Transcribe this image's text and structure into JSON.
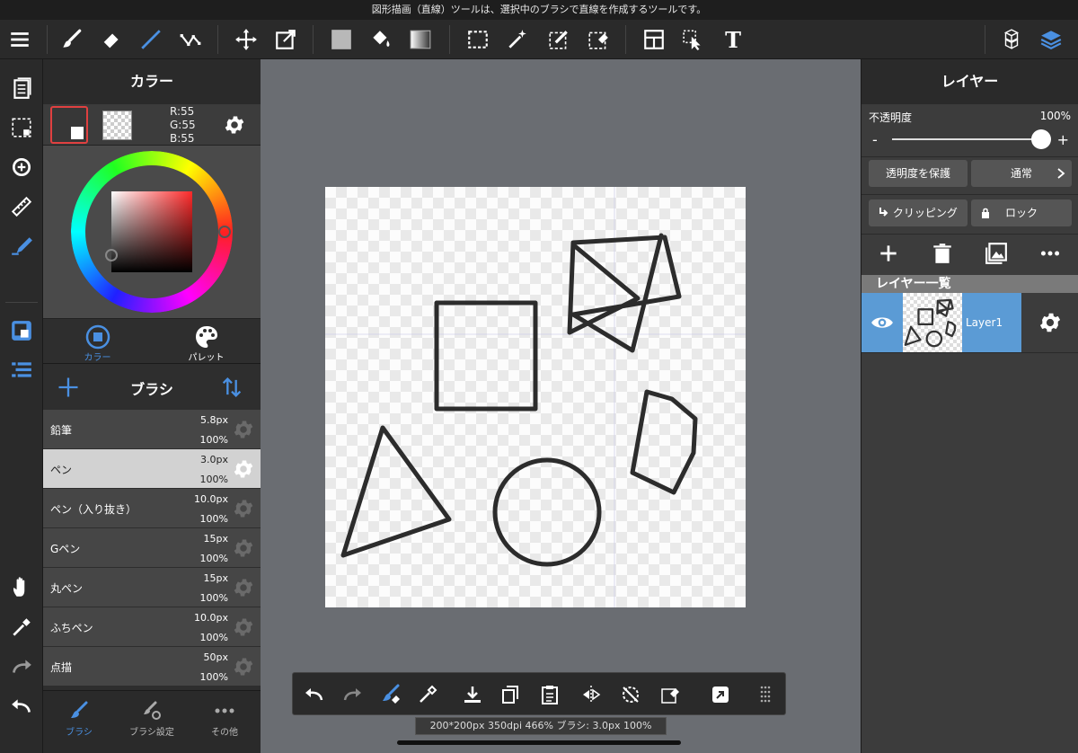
{
  "hint": "図形描画（直線）ツールは、選択中のブラシで直線を作成するツールです。",
  "toolbar": {
    "text_tool_glyph": "T",
    "accent": "#4a90e2"
  },
  "color_panel": {
    "title": "カラー",
    "r": "R:55",
    "g": "G:55",
    "b": "B:55",
    "main_color": "#373737",
    "tab_color": "カラー",
    "tab_palette": "パレット"
  },
  "brush_panel": {
    "title": "ブラシ",
    "brushes": [
      {
        "name": "鉛筆",
        "size": "5.8px",
        "opacity": "100%"
      },
      {
        "name": "ペン",
        "size": "3.0px",
        "opacity": "100%",
        "selected": true
      },
      {
        "name": "ペン（入り抜き）",
        "size": "10.0px",
        "opacity": "100%"
      },
      {
        "name": "Gペン",
        "size": "15px",
        "opacity": "100%"
      },
      {
        "name": "丸ペン",
        "size": "15px",
        "opacity": "100%"
      },
      {
        "name": "ふちペン",
        "size": "10.0px",
        "opacity": "100%"
      },
      {
        "name": "点描",
        "size": "50px",
        "opacity": "100%"
      }
    ]
  },
  "bottom_left_tabs": {
    "brush": "ブラシ",
    "brush_settings": "ブラシ設定",
    "other": "その他"
  },
  "status": "200*200px 350dpi 466% ブラシ: 3.0px 100%",
  "layer_panel": {
    "title": "レイヤー",
    "opacity_label": "不透明度",
    "opacity_value": "100%",
    "opacity_fraction": 1.0,
    "minus": "-",
    "plus": "+",
    "protect_alpha": "透明度を保護",
    "blend_mode": "通常",
    "clipping": "クリッピング",
    "lock": "ロック",
    "list_title": "レイヤー一覧",
    "layers": [
      {
        "name": "Layer1",
        "visible": true
      }
    ]
  }
}
